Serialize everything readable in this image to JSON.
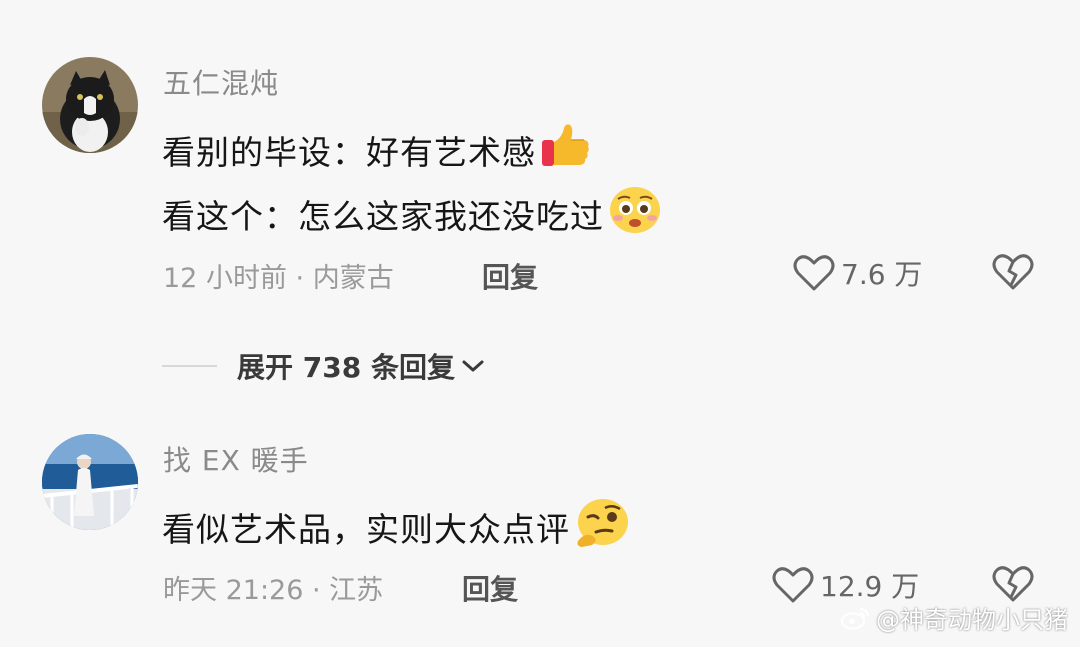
{
  "comments": [
    {
      "username": "五仁混炖",
      "lines": [
        "看别的毕设：好有艺术感",
        "看这个：怎么这家我还没吃过"
      ],
      "time": "12 小时前",
      "location": "内蒙古",
      "reply_label": "回复",
      "likes": "7.6 万",
      "emojis": [
        "thumbs-up-icon",
        "pleading-face-icon"
      ]
    },
    {
      "username": "找 EX 暖手",
      "lines": [
        "看似艺术品，实则大众点评"
      ],
      "time": "昨天 21:26",
      "location": "江苏",
      "reply_label": "回复",
      "likes": "12.9 万",
      "emojis": [
        "thinking-wink-face-icon"
      ]
    }
  ],
  "expand_replies": "展开 738 条回复",
  "watermark": "@神奇动物小只猪",
  "colors": {
    "background": "#f7f7f7",
    "username": "#8a8a8a",
    "meta": "#9a9a9a",
    "text": "#161616"
  }
}
